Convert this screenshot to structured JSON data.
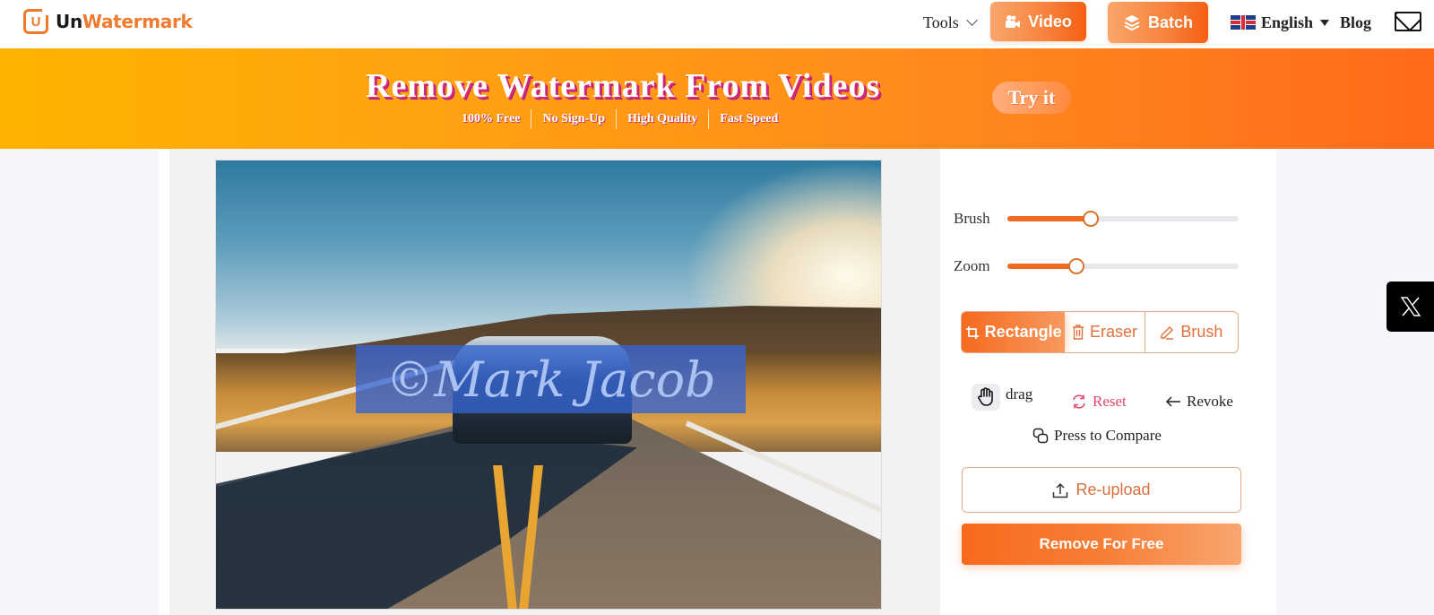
{
  "header": {
    "logo": {
      "prefix": "Un",
      "suffix": "Watermark",
      "mark": "U"
    },
    "nav": {
      "tools_label": "Tools",
      "video_label": "Video",
      "batch_label": "Batch",
      "language_label": "English",
      "blog_label": "Blog"
    },
    "icons": {
      "video": "video-camera-icon",
      "batch": "layers-icon",
      "flag": "uk-flag-icon",
      "mail": "mail-icon"
    }
  },
  "banner": {
    "title": "Remove Watermark From Videos",
    "features": [
      "100% Free",
      "No Sign-Up",
      "High Quality",
      "Fast Speed"
    ],
    "cta_label": "Try it"
  },
  "editor": {
    "watermark_text": "©Mark Jacob",
    "watermark_selection_color": "#3664d2"
  },
  "controls": {
    "sliders": [
      {
        "label": "Brush",
        "value": 0.36
      },
      {
        "label": "Zoom",
        "value": 0.3
      }
    ],
    "tools": [
      {
        "label": "Rectangle",
        "icon": "crop-icon",
        "active": true
      },
      {
        "label": "Eraser",
        "icon": "trash-icon",
        "active": false
      },
      {
        "label": "Brush",
        "icon": "pencil-icon",
        "active": false
      }
    ],
    "drag_label": "drag",
    "reset_label": "Reset",
    "revoke_label": "Revoke",
    "compare_label": "Press to Compare",
    "reupload_label": "Re-upload",
    "remove_label": "Remove For Free"
  },
  "social": {
    "x_icon": "x-twitter-icon"
  },
  "colors": {
    "accent": "#f06a22",
    "reset": "#e0476b",
    "banner_start": "#ffb300",
    "banner_end": "#ff6a1a"
  }
}
